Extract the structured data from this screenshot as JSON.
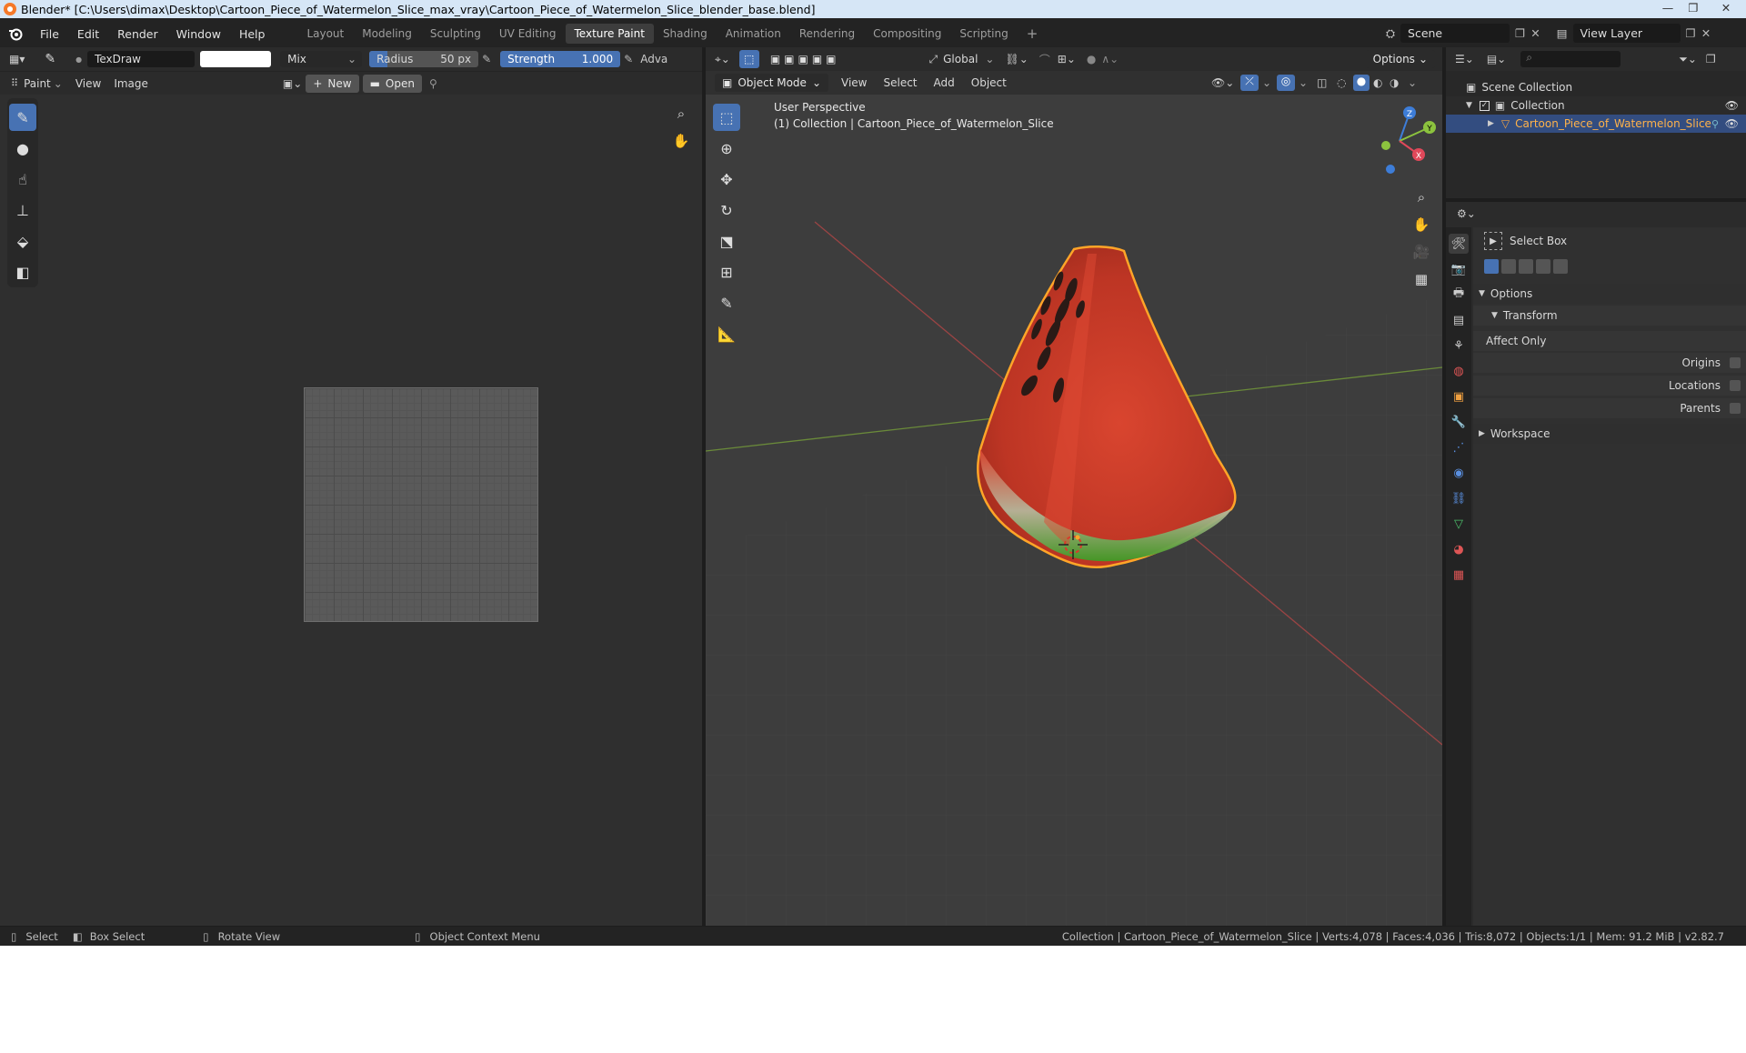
{
  "window": {
    "title": "Blender* [C:\\Users\\dimax\\Desktop\\Cartoon_Piece_of_Watermelon_Slice_max_vray\\Cartoon_Piece_of_Watermelon_Slice_blender_base.blend]",
    "minimize": "—",
    "maximize": "❐",
    "close": "✕"
  },
  "menubar": {
    "file": "File",
    "edit": "Edit",
    "render": "Render",
    "window": "Window",
    "help": "Help"
  },
  "workspaces": [
    "Layout",
    "Modeling",
    "Sculpting",
    "UV Editing",
    "Texture Paint",
    "Shading",
    "Animation",
    "Rendering",
    "Compositing",
    "Scripting"
  ],
  "workspace_add": "+",
  "scene": {
    "label": "Scene",
    "view_layer": "View Layer"
  },
  "image_editor": {
    "brush_name": "TexDraw",
    "blend_mode": "Mix",
    "radius_label": "Radius",
    "radius_value": "50 px",
    "strength_label": "Strength",
    "strength_value": "1.000",
    "adv": "Adva",
    "mode": "Paint",
    "view": "View",
    "image": "Image",
    "new_btn": "New",
    "open_btn": "Open"
  },
  "viewport": {
    "mode": "Object Mode",
    "view": "View",
    "select": "Select",
    "add": "Add",
    "object": "Object",
    "orientation": "Global",
    "options": "Options",
    "perspective": "User Perspective",
    "collection_info": "(1) Collection | Cartoon_Piece_of_Watermelon_Slice",
    "gizmo": {
      "z": "Z",
      "y": "Y",
      "x": "X"
    }
  },
  "outliner": {
    "scene_collection": "Scene Collection",
    "collection": "Collection",
    "object": "Cartoon_Piece_of_Watermelon_Slice"
  },
  "properties": {
    "tool_name": "Select Box",
    "options": "Options",
    "transform": "Transform",
    "affect_only": "Affect Only",
    "origins": "Origins",
    "locations": "Locations",
    "parents": "Parents",
    "workspace": "Workspace"
  },
  "statusbar": {
    "select": "Select",
    "box_select": "Box Select",
    "rotate": "Rotate View",
    "context": "Object Context Menu",
    "info": "Collection | Cartoon_Piece_of_Watermelon_Slice | Verts:4,078 | Faces:4,036 | Tris:8,072 | Objects:1/1 | Mem: 91.2 MiB | v2.82.7"
  },
  "colors": {
    "accent": "#4772b3",
    "selection": "#ffa528",
    "flesh": "#c23b27",
    "rind": "#4aa02a"
  }
}
